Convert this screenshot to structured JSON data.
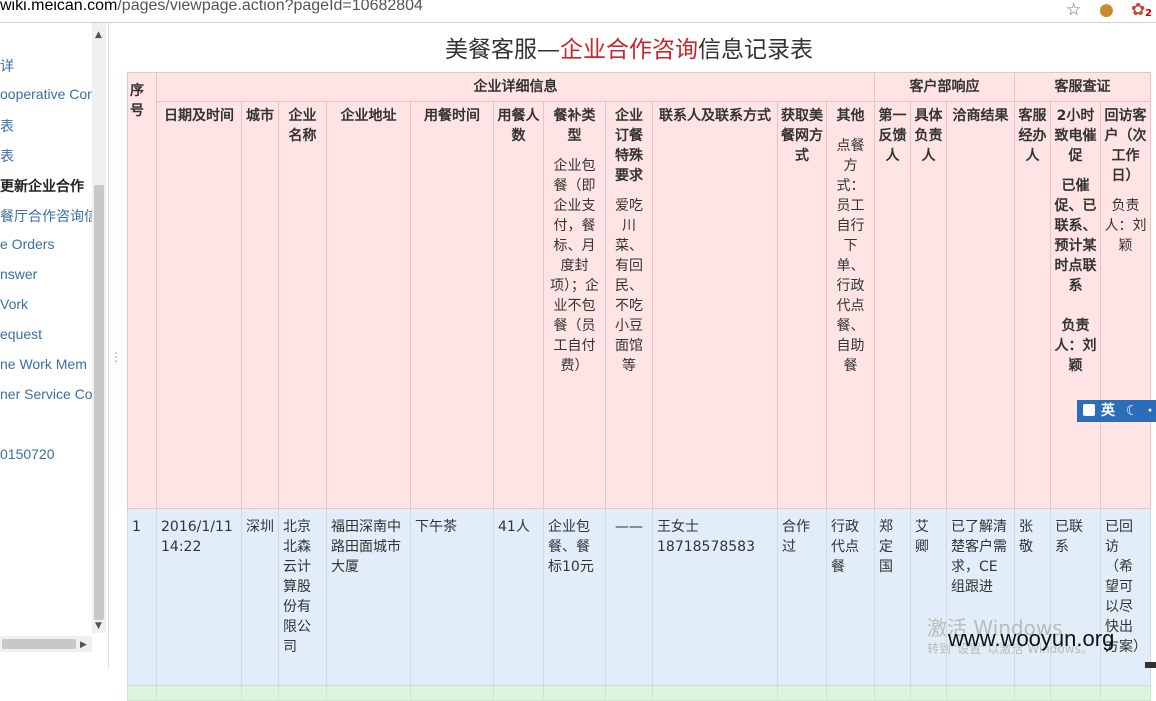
{
  "browser": {
    "url_host": "wiki.meican.com",
    "url_path": "/pages/viewpage.action?pageId=10682804",
    "cookie_badge": "2"
  },
  "sidebar": {
    "items": [
      "详",
      "ooperative Con",
      "表",
      "表",
      "更新企业合作",
      "餐厅合作咨询信",
      "e Orders",
      "nswer",
      "Vork",
      "equest",
      "ne Work Mem",
      "ner Service Co",
      "0150720"
    ]
  },
  "page": {
    "title_a": "美餐客服—",
    "title_b": "企业合作咨询",
    "title_c": "信息记录表"
  },
  "table": {
    "group_headers": [
      "序号",
      "企业详细信息",
      "客户部响应",
      "客服查证"
    ],
    "columns": [
      {
        "title": "日期及时间",
        "note": ""
      },
      {
        "title": "城市",
        "note": ""
      },
      {
        "title": "企业名称",
        "note": ""
      },
      {
        "title": "企业地址",
        "note": ""
      },
      {
        "title": "用餐时间",
        "note": ""
      },
      {
        "title": "用餐人数",
        "note": ""
      },
      {
        "title": "餐补类型",
        "note": "企业包餐（即企业支付，餐标、月度封项）；企业不包餐（员工自付费）"
      },
      {
        "title": "企业订餐特殊要求",
        "note": "爱吃川菜、有回民、不吃小豆面馆等"
      },
      {
        "title": "联系人及联系方式",
        "note": ""
      },
      {
        "title": "获取美餐网方式",
        "note": ""
      },
      {
        "title": "其他",
        "note": "点餐方式：员工自行下单、行政代点餐、自助餐"
      },
      {
        "title": "第一反馈人",
        "note": ""
      },
      {
        "title": "具体负责人",
        "note": ""
      },
      {
        "title": "洽商结果",
        "note": ""
      },
      {
        "title": "客服经办人",
        "note": ""
      },
      {
        "title": "2小时致电催促",
        "note": "已催促、已联系、预计某时点联系\n\n负责人：刘颖"
      },
      {
        "title": "回访客户（次工作日）",
        "note": "负责人：刘颖"
      }
    ],
    "rows": [
      {
        "seq": "1",
        "cells": [
          "2016/1/11 14:22",
          "深圳",
          "北京北森云计算股份有限公司",
          "福田深南中路田面城市大厦",
          "下午茶",
          "41人",
          "企业包餐、餐标10元",
          "——",
          "王女士 18718578583",
          "合作过",
          "行政代点餐",
          "郑定国",
          "艾卿",
          "已了解清楚客户需求，CE组跟进",
          "张敬",
          "已联系",
          "已回访（希望可以尽快出方案）"
        ]
      }
    ]
  },
  "overlay": {
    "ime_label": "英",
    "watermark_line1": "激活 Windows",
    "watermark_line2": "转到“设置”以激活 Windows。",
    "source_mark": "www.wooyun.org"
  }
}
